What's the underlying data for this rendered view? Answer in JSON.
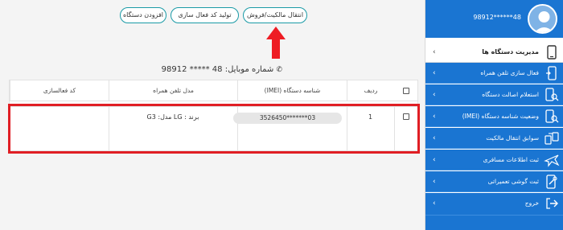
{
  "sidebar": {
    "phone_masked": "98912******48",
    "header_label": "مدیریت دستگاه ها",
    "items": [
      {
        "label": "فعال سازی تلفن همراه"
      },
      {
        "label": "استعلام اصالت دستگاه"
      },
      {
        "label": "وضعیت شناسه دستگاه (IMEI)"
      },
      {
        "label": "سوابق انتقال مالکیت"
      },
      {
        "label": "ثبت اطلاعات مسافری"
      },
      {
        "label": "ثبت گوشی تعمیراتی"
      },
      {
        "label": "خروج"
      }
    ]
  },
  "toolbar": {
    "transfer_label": "انتقال مالکیت/فروش",
    "generate_code_label": "تولید کد فعال سازی",
    "add_device_label": "افزودن دستگاه"
  },
  "mobile": {
    "label": "شماره موبایل:",
    "number": "98912 ***** 48"
  },
  "table": {
    "headers": {
      "row": "ردیف",
      "imei": "شناسه دستگاه (IMEI)",
      "model": "مدل تلفن همراه",
      "activation_code": "کد فعالسازی"
    },
    "rows": [
      {
        "index": "1",
        "imei": "3526450*******03",
        "model": "برند : LG مدل: G3",
        "activation_code": ""
      }
    ]
  },
  "colors": {
    "sidebar_blue": "#1a75d2",
    "button_border": "#1a9aa6",
    "highlight_red": "#e01e24"
  }
}
